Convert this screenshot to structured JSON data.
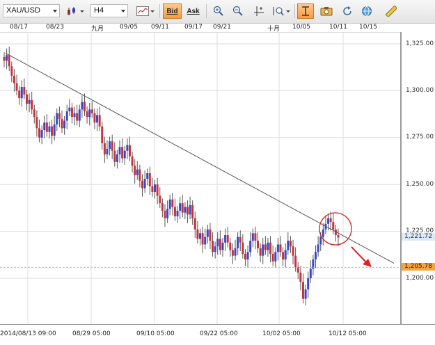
{
  "toolbar": {
    "symbol": "XAU/USD",
    "timeframe": "H4",
    "bid_label": "Bid",
    "ask_label": "Ask"
  },
  "chart_data": {
    "type": "candlestick",
    "symbol": "XAU/USD",
    "interval": "H4",
    "top_date_labels": [
      "08/17",
      "08/23",
      "九月",
      "09/05",
      "09/11",
      "09/17",
      "09/21",
      "十月",
      "10/05",
      "10/11",
      "10/15"
    ],
    "price_ticks": [
      "1,325.00",
      "1,300.00",
      "1,275.00",
      "1,250.00",
      "1,225.00",
      "1,200.00"
    ],
    "time_ticks": [
      "2014/08/13 09:00",
      "08/29 05:00",
      "09/10 05:00",
      "09/22 05:00",
      "10/02 05:00",
      "10/12 05:00"
    ],
    "bid_price": "1,221.72",
    "ask_price": "1,205.78",
    "ylim": [
      1180,
      1330
    ],
    "grid": true,
    "trendline": {
      "from_price": 1320,
      "to_price": 1208
    },
    "annotations": [
      "circle",
      "arrow"
    ],
    "up_color": "#3a48c6",
    "down_color": "#c8323c",
    "bid_tag_color": "#dce9f7",
    "ask_tag_color": "#f5a33c",
    "close_prices": [
      1316,
      1319,
      1313,
      1308,
      1304,
      1300,
      1296,
      1302,
      1298,
      1293,
      1295,
      1290,
      1286,
      1280,
      1275,
      1279,
      1283,
      1278,
      1281,
      1276,
      1282,
      1288,
      1285,
      1280,
      1284,
      1289,
      1291,
      1286,
      1288,
      1284,
      1290,
      1294,
      1289,
      1286,
      1290,
      1288,
      1283,
      1287,
      1281,
      1272,
      1266,
      1269,
      1273,
      1268,
      1262,
      1266,
      1270,
      1264,
      1268,
      1271,
      1265,
      1260,
      1255,
      1258,
      1252,
      1248,
      1253,
      1256,
      1249,
      1246,
      1250,
      1244,
      1240,
      1236,
      1232,
      1237,
      1242,
      1238,
      1233,
      1236,
      1240,
      1235,
      1238,
      1234,
      1239,
      1232,
      1226,
      1221,
      1224,
      1218,
      1222,
      1226,
      1220,
      1214,
      1217,
      1221,
      1215,
      1219,
      1223,
      1219,
      1215,
      1212,
      1216,
      1222,
      1219,
      1213,
      1210,
      1214,
      1220,
      1224,
      1220,
      1216,
      1212,
      1218,
      1215,
      1219,
      1213,
      1209,
      1214,
      1218,
      1214,
      1210,
      1215,
      1220,
      1217,
      1212,
      1206,
      1203,
      1198,
      1189,
      1194,
      1200,
      1205,
      1210,
      1214,
      1218,
      1222,
      1226,
      1229,
      1232,
      1230,
      1226,
      1223,
      1221.72
    ]
  }
}
